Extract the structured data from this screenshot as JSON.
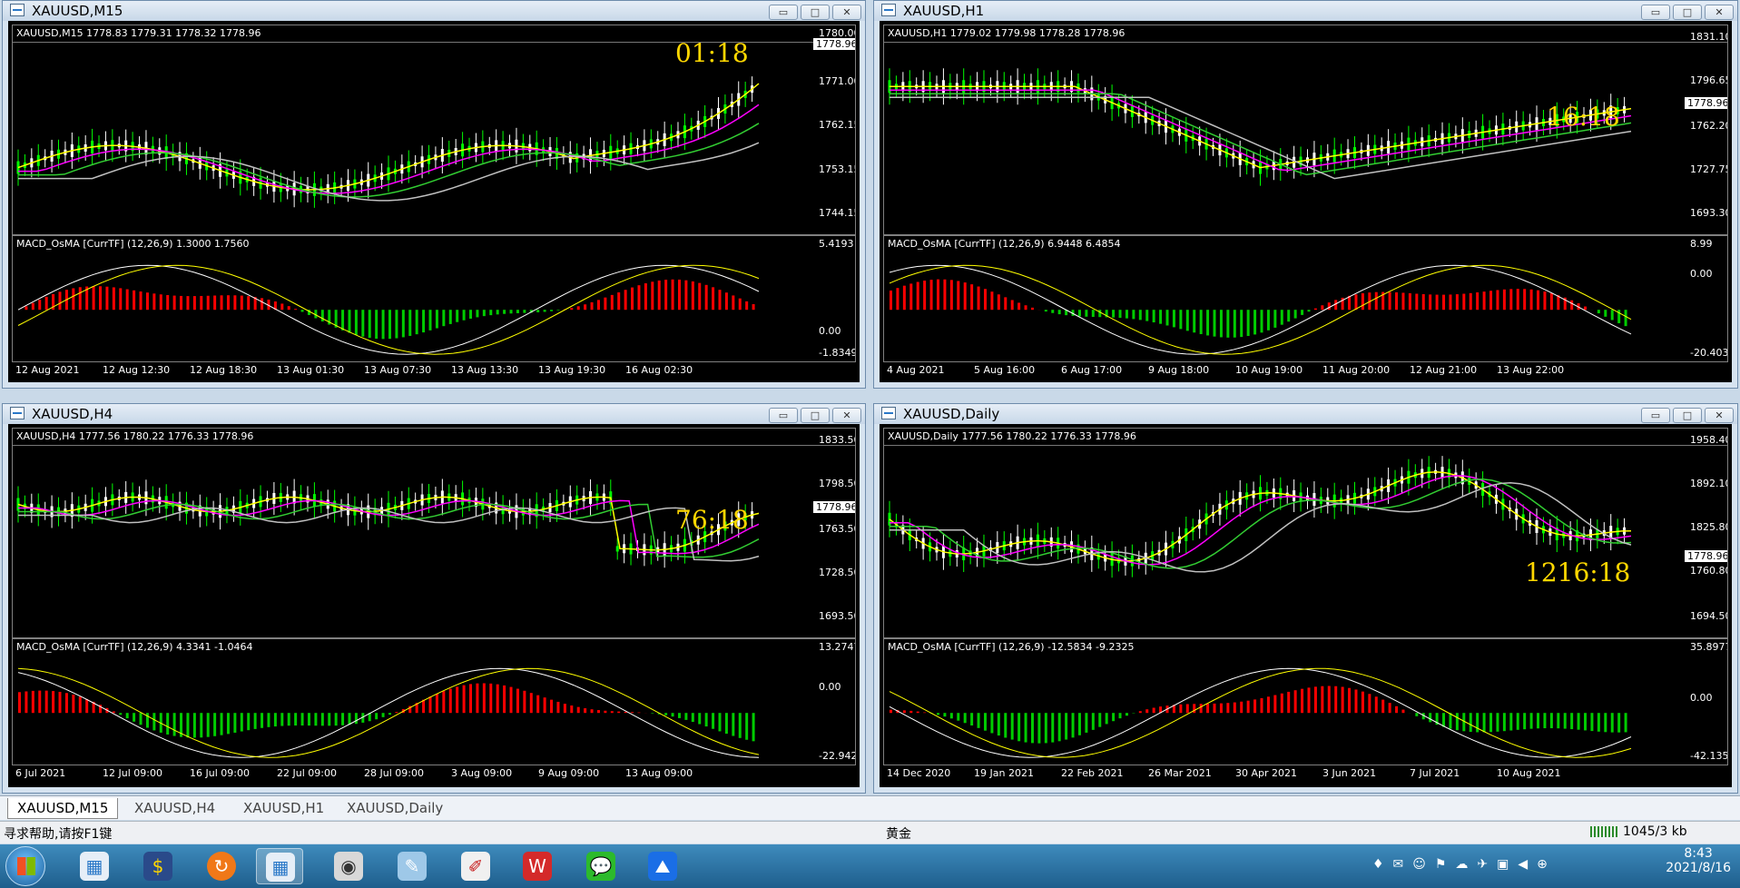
{
  "windows": [
    {
      "title": "XAUUSD,M15",
      "ohlc": "XAUUSD,M15  1778.83 1779.31 1778.32 1778.96",
      "timer": "01:18",
      "price_ticks": [
        "1780.00",
        "1771.00",
        "1762.15",
        "1753.15",
        "1744.15"
      ],
      "current_price": "1778.96",
      "macd_label": "MACD_OsMA [CurrTF] (12,26,9) 1.3000 1.7560",
      "macd_ticks": [
        "5.4193",
        "0.00",
        "-1.8349"
      ],
      "dates": [
        "12 Aug 2021",
        "12 Aug 12:30",
        "12 Aug 18:30",
        "13 Aug 01:30",
        "13 Aug 07:30",
        "13 Aug 13:30",
        "13 Aug 19:30",
        "16 Aug 02:30"
      ]
    },
    {
      "title": "XAUUSD,H1",
      "ohlc": "XAUUSD,H1  1779.02 1779.98 1778.28 1778.96",
      "timer": "16:18",
      "price_ticks": [
        "1831.10",
        "1796.65",
        "1762.20",
        "1727.75",
        "1693.30"
      ],
      "current_price": "1778.96",
      "macd_label": "MACD_OsMA [CurrTF] (12,26,9) 6.9448 6.4854",
      "macd_ticks": [
        "8.99",
        "0.00",
        "-20.4039"
      ],
      "dates": [
        "4 Aug 2021",
        "5 Aug 16:00",
        "6 Aug 17:00",
        "9 Aug 18:00",
        "10 Aug 19:00",
        "11 Aug 20:00",
        "12 Aug 21:00",
        "13 Aug 22:00"
      ]
    },
    {
      "title": "XAUUSD,H4",
      "ohlc": "XAUUSD,H4  1777.56 1780.22 1776.33 1778.96",
      "timer": "76:18",
      "price_ticks": [
        "1833.50",
        "1798.50",
        "1763.50",
        "1728.50",
        "1693.50"
      ],
      "current_price": "1778.96",
      "macd_label": "MACD_OsMA [CurrTF] (12,26,9) 4.3341 -1.0464",
      "macd_ticks": [
        "13.2747",
        "0.00",
        "-22.9429"
      ],
      "dates": [
        "6 Jul 2021",
        "12 Jul 09:00",
        "16 Jul 09:00",
        "22 Jul 09:00",
        "28 Jul 09:00",
        "3 Aug 09:00",
        "9 Aug 09:00",
        "13 Aug 09:00"
      ]
    },
    {
      "title": "XAUUSD,Daily",
      "ohlc": "XAUUSD,Daily  1777.56 1780.22 1776.33 1778.96",
      "timer": "1216:18",
      "price_ticks": [
        "1958.40",
        "1892.10",
        "1825.80",
        "1760.80",
        "1694.50"
      ],
      "current_price": "1778.96",
      "macd_label": "MACD_OsMA [CurrTF] (12,26,9) -12.5834 -9.2325",
      "macd_ticks": [
        "35.8977",
        "0.00",
        "-42.1359"
      ],
      "dates": [
        "14 Dec 2020",
        "19 Jan 2021",
        "22 Feb 2021",
        "26 Mar 2021",
        "30 Apr 2021",
        "3 Jun 2021",
        "7 Jul 2021",
        "10 Aug 2021"
      ]
    }
  ],
  "window_buttons": {
    "minimize": "▭",
    "maximize": "□",
    "close": "✕"
  },
  "tabs": [
    "XAUUSD,M15",
    "XAUUSD,H4",
    "XAUUSD,H1",
    "XAUUSD,Daily"
  ],
  "status": {
    "help": "寻求帮助,请按F1键",
    "symbol": "黄金",
    "traffic": "1045/3 kb"
  },
  "taskbar": {
    "time": "8:43",
    "date": "2021/8/16"
  },
  "colors": {
    "bull_candle": "#00ff00",
    "bear_candle": "#ffffff",
    "ma_yellow": "#ffff00",
    "ma_magenta": "#ff00ff",
    "ma_green": "#32cd32",
    "ma_silver": "#c0c0c0",
    "hist_up": "#ff0000",
    "hist_down": "#00cc00",
    "timer": "#ffd700"
  }
}
